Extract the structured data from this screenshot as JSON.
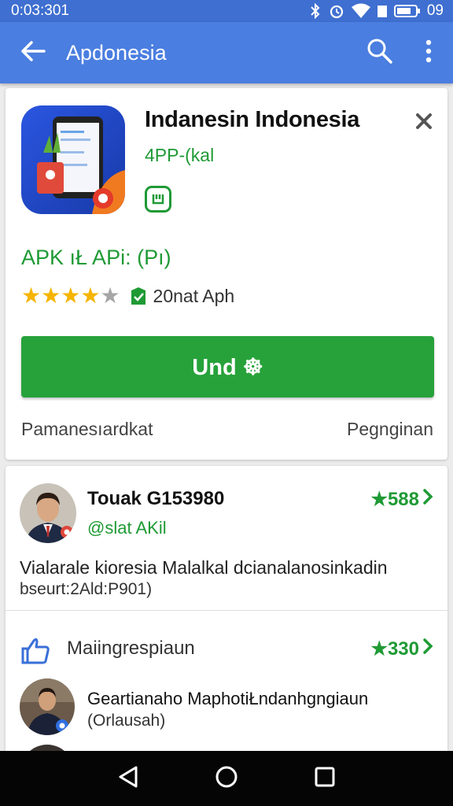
{
  "status_bar": {
    "time": "0:03:301",
    "battery": "09"
  },
  "app_bar": {
    "title": "Apdonesia"
  },
  "app": {
    "name": "Indanesin Indonesia",
    "developer": "4PP-(kal",
    "apk_line": "APK ıŁ APi: (Pı)",
    "rating_stars": 4,
    "rating_max": 5,
    "downloads": "20nat Aph",
    "install_label": "Und ☸",
    "info_left": "Pamanesıardkat",
    "info_right": "Pegnginan"
  },
  "reviews": {
    "first": {
      "name": "Touak G153980",
      "handle": "@slat AKil",
      "score": "★588",
      "text": "Vialarale kioresia Malalkal dcianalanosinkadin",
      "sub": "bseurt:2Ald:P901)"
    },
    "section": {
      "title": "Maiingrespiaun",
      "score": "★330"
    },
    "second": {
      "name": "Geartianaho MaphotiŁndanhgngiaun",
      "handle": "(Orlausah)"
    }
  },
  "colors": {
    "primary_blue": "#4a7ee0",
    "accent_green": "#27a23a",
    "star_gold": "#f5b400"
  },
  "icons": [
    "back-arrow-icon",
    "search-icon",
    "more-vert-icon",
    "close-icon",
    "badge-icon",
    "shield-icon",
    "thumb-up-icon",
    "chevron-right-icon",
    "nav-back-icon",
    "nav-home-icon",
    "nav-recents-icon"
  ]
}
